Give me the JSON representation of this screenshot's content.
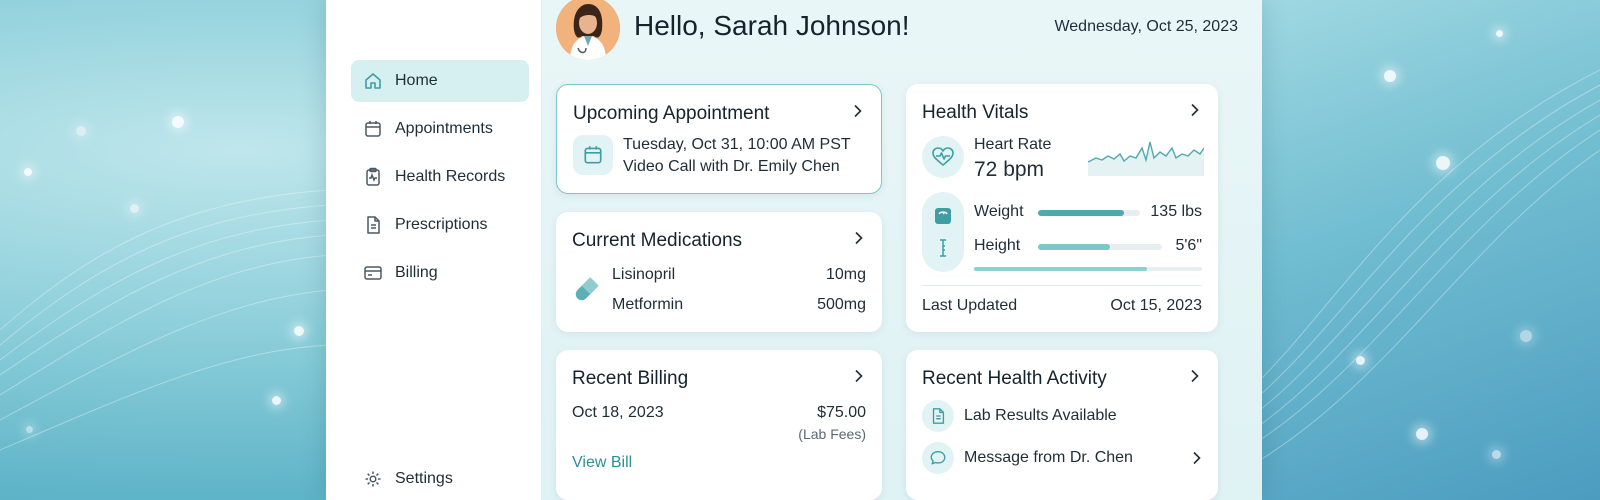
{
  "greeting": "Hello, Sarah Johnson!",
  "date": "Wednesday, Oct 25, 2023",
  "colors": {
    "accent": "#3e9ea3",
    "active_nav": "#d6f0f1",
    "link": "#2b8f96"
  },
  "sidebar": {
    "items": [
      {
        "label": "Home",
        "icon": "home-icon",
        "active": true
      },
      {
        "label": "Appointments",
        "icon": "calendar-icon",
        "active": false
      },
      {
        "label": "Health Records",
        "icon": "clipboard-pulse-icon",
        "active": false
      },
      {
        "label": "Prescriptions",
        "icon": "document-icon",
        "active": false
      },
      {
        "label": "Billing",
        "icon": "credit-card-icon",
        "active": false
      }
    ],
    "settings": {
      "label": "Settings",
      "icon": "gear-icon"
    }
  },
  "appointment": {
    "title": "Upcoming Appointment",
    "datetime": "Tuesday, Oct 31, 10:00 AM PST",
    "description": "Video Call with Dr. Emily Chen"
  },
  "medications": {
    "title": "Current Medications",
    "items": [
      {
        "name": "Lisinopril",
        "dose": "10mg"
      },
      {
        "name": "Metformin",
        "dose": "500mg"
      }
    ]
  },
  "vitals": {
    "title": "Health Vitals",
    "heart_rate_label": "Heart Rate",
    "heart_rate_value": "72 bpm",
    "weight_label": "Weight",
    "weight_value": "135 lbs",
    "weight_level": 0.84,
    "height_label": "Height",
    "height_value": "5'6\"",
    "height_level": 0.58,
    "overall_level": 0.76,
    "last_updated_label": "Last Updated",
    "last_updated_value": "Oct 15, 2023"
  },
  "billing": {
    "title": "Recent Billing",
    "date": "Oct 18, 2023",
    "amount": "$75.00",
    "note": "(Lab Fees)",
    "link": "View Bill"
  },
  "activity": {
    "title": "Recent Health Activity",
    "items": [
      {
        "label": "Lab Results Available",
        "icon": "document-icon"
      },
      {
        "label": "Message from Dr. Chen",
        "icon": "chat-bubble-icon"
      }
    ]
  }
}
